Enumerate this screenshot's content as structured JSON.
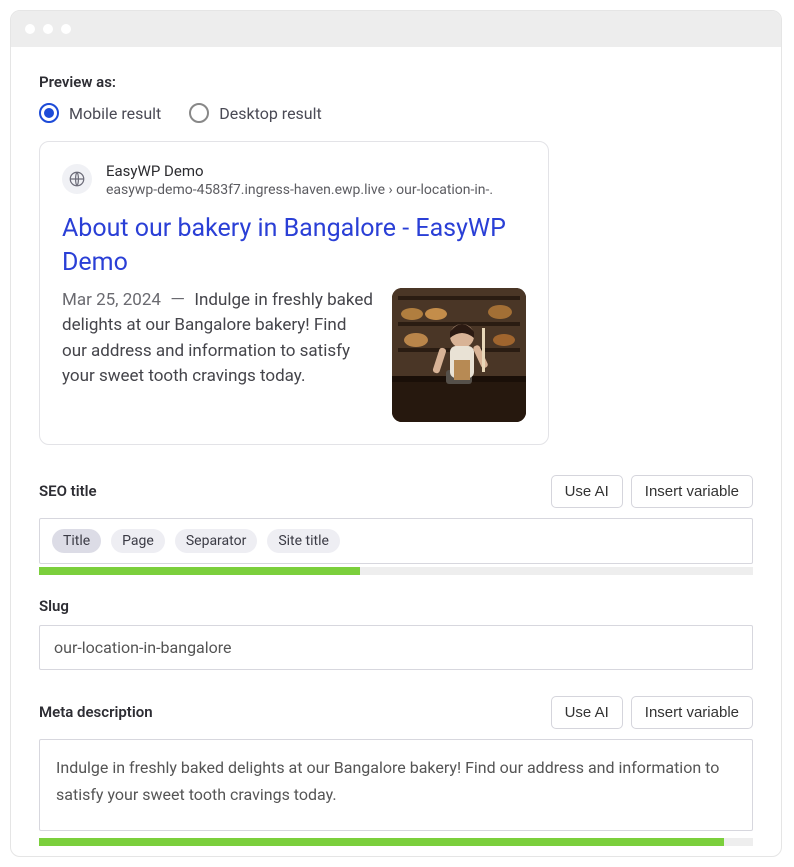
{
  "previewAs": {
    "label": "Preview as:",
    "options": {
      "mobile": "Mobile result",
      "desktop": "Desktop result"
    },
    "selected": "mobile"
  },
  "serp": {
    "siteName": "EasyWP Demo",
    "breadcrumb": "easywp-demo-4583f7.ingress-haven.ewp.live › our-location-in-.",
    "title": "About our bakery in Bangalore - EasyWP Demo",
    "date": "Mar 25, 2024",
    "dash": "－",
    "description": "Indulge in freshly baked delights at our Bangalore bakery! Find our address and information to satisfy your sweet tooth cravings today."
  },
  "seoTitle": {
    "label": "SEO title",
    "useAi": "Use AI",
    "insertVariable": "Insert variable",
    "chips": [
      "Title",
      "Page",
      "Separator",
      "Site title"
    ],
    "progressPercent": 45
  },
  "slug": {
    "label": "Slug",
    "value": "our-location-in-bangalore"
  },
  "metaDescription": {
    "label": "Meta description",
    "useAi": "Use AI",
    "insertVariable": "Insert variable",
    "value": "Indulge in freshly baked delights at our Bangalore bakery! Find our address and information to satisfy your sweet tooth cravings today.",
    "progressPercent": 96
  }
}
